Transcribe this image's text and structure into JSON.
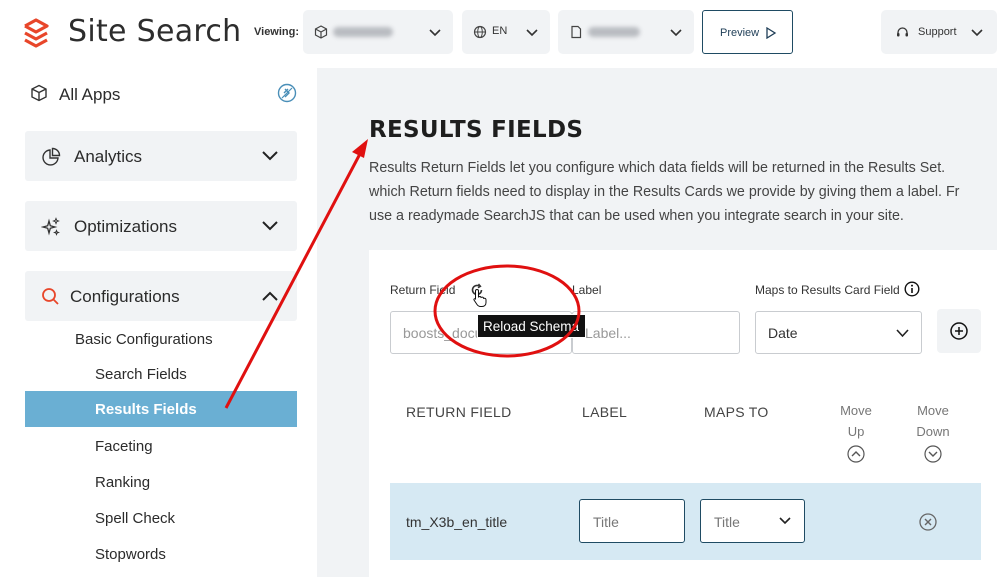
{
  "header": {
    "app_title": "Site Search",
    "viewing_label": "Viewing:",
    "language": "EN",
    "preview_label": "Preview",
    "support_label": "Support"
  },
  "sidebar": {
    "all_apps": "All Apps",
    "analytics": "Analytics",
    "optimizations": "Optimizations",
    "configurations": "Configurations",
    "basic_configurations": "Basic Configurations",
    "items": [
      "Search Fields",
      "Results Fields",
      "Faceting",
      "Ranking",
      "Spell Check",
      "Stopwords"
    ],
    "active_item": "Results Fields"
  },
  "main": {
    "title": "RESULTS FIELDS",
    "description": [
      "Results Return Fields let you configure which data fields will be returned in the Results Set.",
      "which Return fields need to display in the Results Cards we provide by giving them a label. Fr",
      "use a readymade SearchJS that can be used when you integrate search in your site."
    ],
    "form": {
      "return_field_label": "Return Field",
      "return_field_value": "boosts_docu",
      "label_label": "Label",
      "label_placeholder": "Label...",
      "maps_to_label": "Maps to Results Card Field",
      "maps_to_value": "Date",
      "reload_tooltip": "Reload Schema"
    },
    "table": {
      "headers": {
        "return_field": "RETURN FIELD",
        "label": "LABEL",
        "maps_to": "MAPS TO",
        "move_up": [
          "Move",
          "Up"
        ],
        "move_down": [
          "Move",
          "Down"
        ]
      },
      "rows": [
        {
          "return_field": "tm_X3b_en_title",
          "label": "Title",
          "maps_to": "Title"
        }
      ]
    }
  },
  "colors": {
    "brand": "#e8462a",
    "active_item": "#6aafd3",
    "row_highlight": "#d6e9f3",
    "annotation": "#e01010"
  }
}
